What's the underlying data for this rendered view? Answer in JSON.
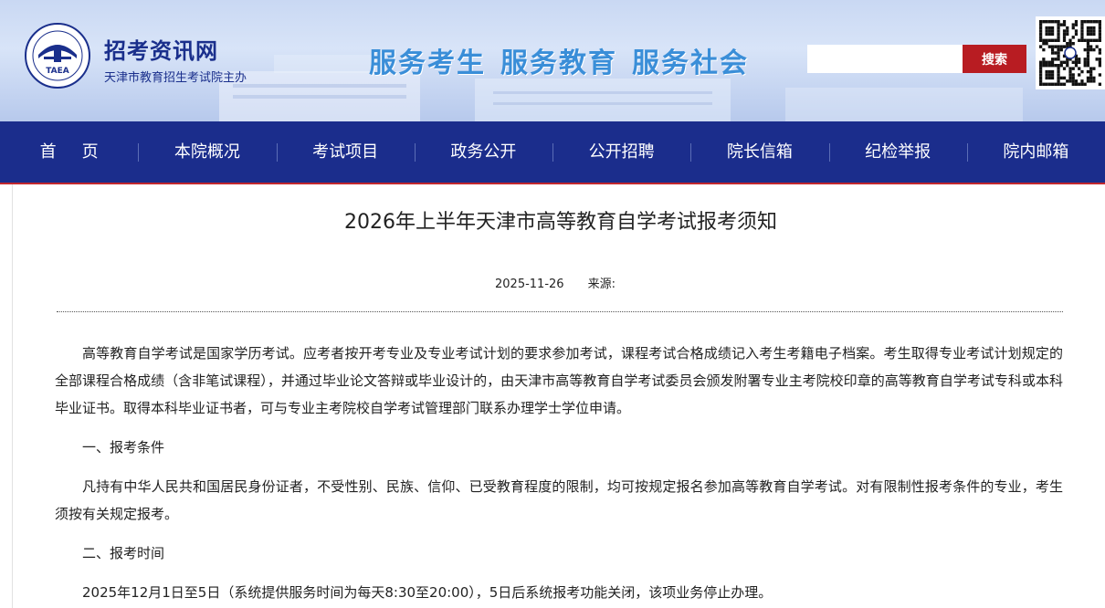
{
  "header": {
    "site_name": "招考资讯网",
    "site_sub": "天津市教育招生考试院主办",
    "logo_text": "TAEA",
    "slogan": [
      "服务考生",
      "服务教育",
      "服务社会"
    ],
    "search": {
      "placeholder": "",
      "button_label": "搜索"
    }
  },
  "nav": {
    "items": [
      "首页",
      "本院概况",
      "考试项目",
      "政务公开",
      "公开招聘",
      "院长信箱",
      "纪检举报",
      "院内邮箱"
    ]
  },
  "article": {
    "title": "2026年上半年天津市高等教育自学考试报考须知",
    "date": "2025-11-26",
    "source_label": "来源:",
    "paragraphs": [
      "高等教育自学考试是国家学历考试。应考者按开考专业及专业考试计划的要求参加考试，课程考试合格成绩记入考生考籍电子档案。考生取得专业考试计划规定的全部课程合格成绩（含非笔试课程），并通过毕业论文答辩或毕业设计的，由天津市高等教育自学考试委员会颁发附署专业主考院校印章的高等教育自学考试专科或本科毕业证书。取得本科毕业证书者，可与专业主考院校自学考试管理部门联系办理学士学位申请。",
      "一、报考条件",
      "凡持有中华人民共和国居民身份证者，不受性别、民族、信仰、已受教育程度的限制，均可按规定报名参加高等教育自学考试。对有限制性报考条件的专业，考生须按有关规定报考。",
      "二、报考时间",
      "2025年12月1日至5日（系统提供服务时间为每天8:30至20:00），5日后系统报考功能关闭，该项业务停止办理。"
    ]
  },
  "colors": {
    "nav_bg": "#1b2d8c",
    "search_button": "#b81c22",
    "slogan": "#3a8ed8",
    "site_name": "#1a2f8c"
  },
  "icons": {
    "logo": "taea-emblem-icon",
    "qr": "qr-code-icon"
  }
}
